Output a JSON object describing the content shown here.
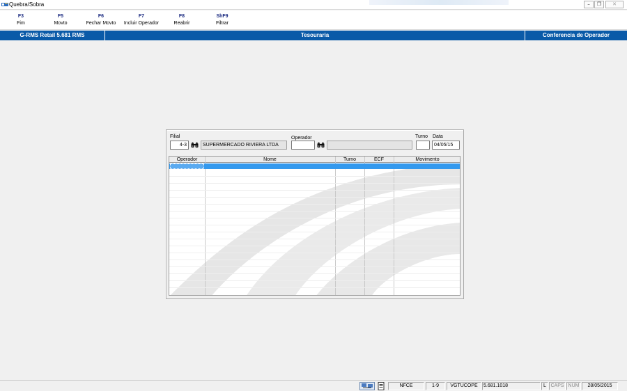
{
  "window": {
    "title": "Quebra/Sobra"
  },
  "toolbar": {
    "items": [
      {
        "key": "F3",
        "label": "Fim"
      },
      {
        "key": "F5",
        "label": "Movto"
      },
      {
        "key": "F6",
        "label": "Fechar Movto"
      },
      {
        "key": "F7",
        "label": "Incluir Operador"
      },
      {
        "key": "F8",
        "label": "Reabrir"
      },
      {
        "key": "ShF9",
        "label": "Filtrar"
      }
    ]
  },
  "header": {
    "app_version": "G-RMS Retail 5.681 RMS",
    "module": "Tesouraria",
    "screen": "Conferencia de Operador"
  },
  "form": {
    "filial_label": "Filial",
    "filial_value": "4-3",
    "filial_name": "SUPERMERCADO RIVIERA LTDA",
    "operador_label": "Operador",
    "operador_value": "",
    "operador_name": "",
    "turno_label": "Turno",
    "turno_value": "",
    "data_label": "Data",
    "data_value": "04/05/15"
  },
  "table": {
    "columns": [
      "Operador",
      "Nome",
      "Turno",
      "ECF",
      "Movimento"
    ],
    "rows": []
  },
  "statusbar": {
    "mode": "NFCE",
    "page": "1-9",
    "program": "VGTUCOPE",
    "version": "5.681.1018",
    "flag": "L",
    "caps": "CAPS",
    "num": "NUM",
    "date": "28/05/2015"
  },
  "icons": {
    "app": "app-icon",
    "lookup": "binoculars-icon",
    "network": "network-icon",
    "document": "document-icon"
  },
  "colors": {
    "header_bg": "#0a5aa8",
    "selection": "#3399ee",
    "toolbar_key": "#1a2a80"
  }
}
